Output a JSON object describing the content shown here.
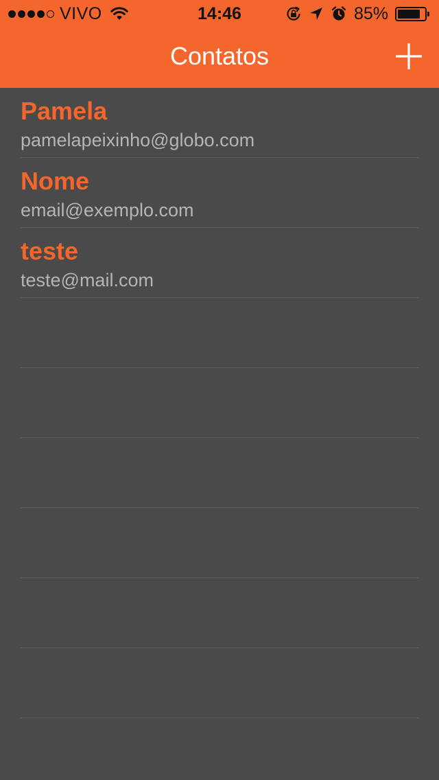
{
  "status_bar": {
    "carrier": "VIVO",
    "time": "14:46",
    "battery_percent": "85%",
    "battery_level": 0.85,
    "signal_bars_filled": 4,
    "signal_bars_total": 5,
    "icons": [
      "wifi-icon",
      "rotation-lock-icon",
      "location-arrow-icon",
      "alarm-icon",
      "battery-icon"
    ]
  },
  "navbar": {
    "title": "Contatos",
    "add_icon": "plus-icon"
  },
  "colors": {
    "accent": "#f4662c",
    "background": "#4a4a4a",
    "separator": "#5e5e5e",
    "secondary_text": "#b5b5b5"
  },
  "contacts": [
    {
      "name": "Pamela",
      "email": "pamelapeixinho@globo.com"
    },
    {
      "name": "Nome",
      "email": "email@exemplo.com"
    },
    {
      "name": "teste",
      "email": "teste@mail.com"
    },
    {
      "name": "",
      "email": ""
    },
    {
      "name": "",
      "email": ""
    },
    {
      "name": "",
      "email": ""
    },
    {
      "name": "",
      "email": ""
    },
    {
      "name": "",
      "email": ""
    },
    {
      "name": "",
      "email": ""
    }
  ]
}
